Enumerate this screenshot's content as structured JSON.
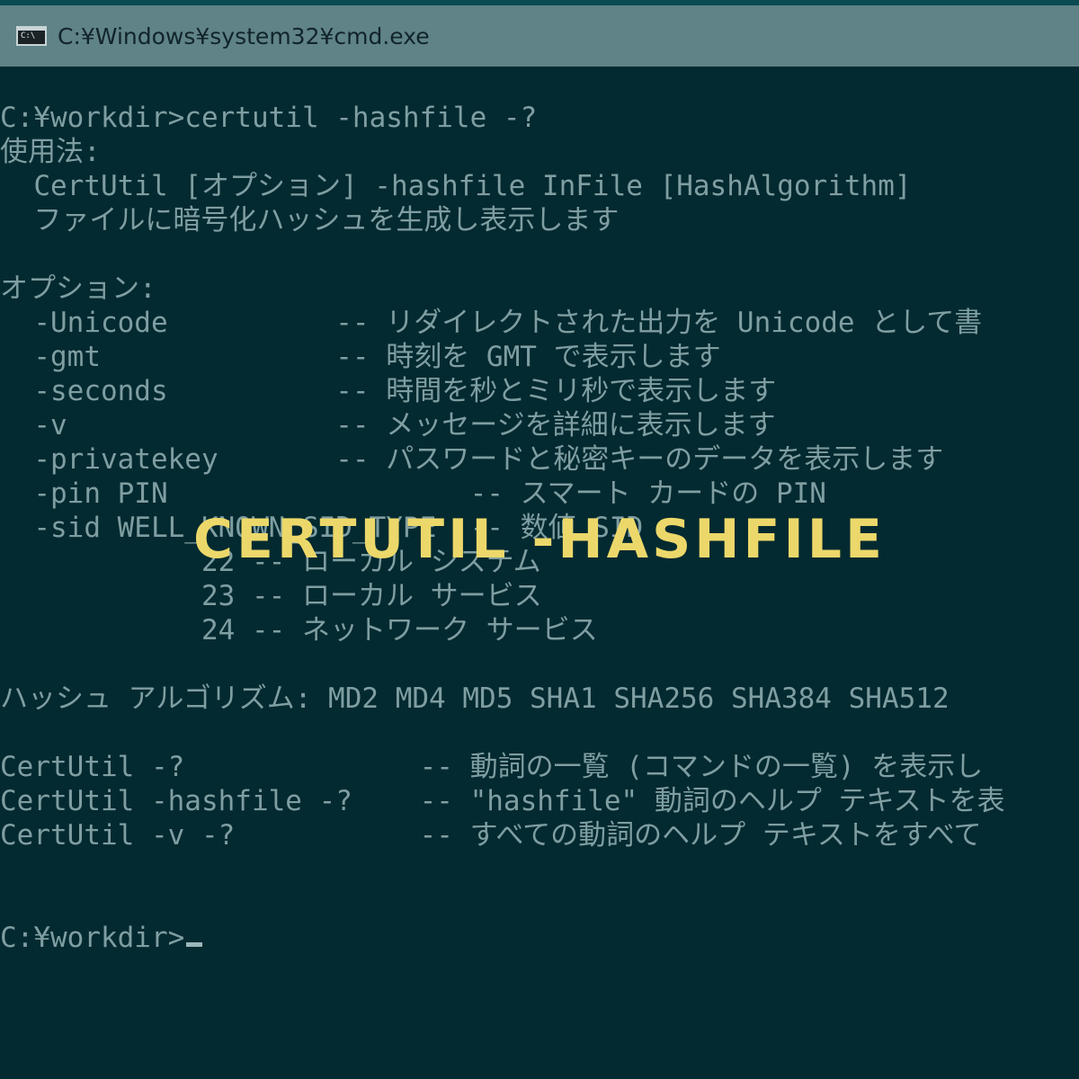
{
  "window": {
    "title": "C:¥Windows¥system32¥cmd.exe",
    "icon": "cmd-icon",
    "icon_glyph": "C:\\"
  },
  "console": {
    "lines": [
      "C:¥workdir>certutil -hashfile -?",
      "使用法:",
      "  CertUtil [オプション] -hashfile InFile [HashAlgorithm]",
      "  ファイルに暗号化ハッシュを生成し表示します",
      "",
      "オプション:",
      "  -Unicode          -- リダイレクトされた出力を Unicode として書",
      "  -gmt              -- 時刻を GMT で表示します",
      "  -seconds          -- 時間を秒とミリ秒で表示します",
      "  -v                -- メッセージを詳細に表示します",
      "  -privatekey       -- パスワードと秘密キーのデータを表示します",
      "  -pin PIN                  -- スマート カードの PIN",
      "  -sid WELL_KNOWN_SID_TYPE  -- 数値 SID",
      "            22 -- ローカル システム",
      "            23 -- ローカル サービス",
      "            24 -- ネットワーク サービス",
      "",
      "ハッシュ アルゴリズム: MD2 MD4 MD5 SHA1 SHA256 SHA384 SHA512",
      "",
      "CertUtil -?              -- 動詞の一覧 (コマンドの一覧) を表示し",
      "CertUtil -hashfile -?    -- \"hashfile\" 動詞のヘルプ テキストを表",
      "CertUtil -v -?           -- すべての動詞のヘルプ テキストをすべて",
      "",
      "",
      "C:¥workdir>"
    ]
  },
  "overlay": {
    "title": "CERTUTIL -HASHFILE"
  },
  "colors": {
    "background": "#032a30",
    "titlebar": "#5f8387",
    "text": "#7f9ea2",
    "overlay": "#ecd86a"
  }
}
